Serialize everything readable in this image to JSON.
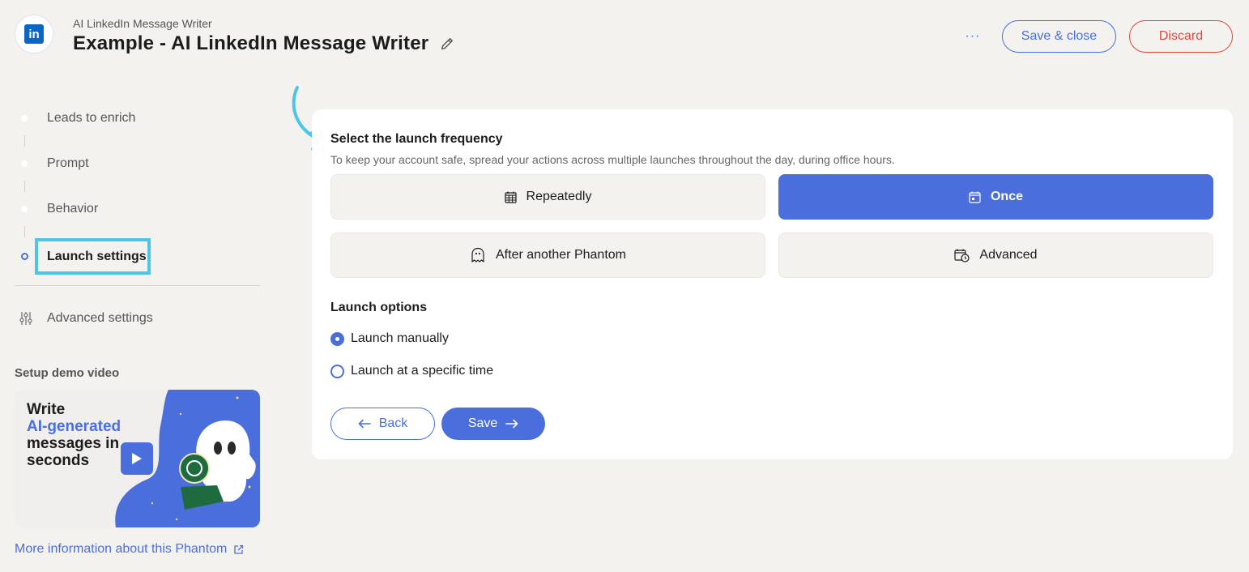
{
  "header": {
    "subtitle": "AI LinkedIn Message Writer",
    "title": "Example - AI LinkedIn Message Writer",
    "logo_text": "in",
    "more_label": "···",
    "save_close_label": "Save & close",
    "discard_label": "Discard"
  },
  "sidebar": {
    "steps": [
      {
        "label": "Leads to enrich"
      },
      {
        "label": "Prompt"
      },
      {
        "label": "Behavior"
      },
      {
        "label": "Launch settings"
      }
    ],
    "advanced_label": "Advanced settings",
    "demo_heading": "Setup demo video",
    "demo": {
      "line1": "Write",
      "line2": "AI-generated",
      "line3": "messages in",
      "line4": "seconds"
    },
    "more_info_label": "More information about this Phantom"
  },
  "main": {
    "section_title": "Select the launch frequency",
    "section_desc": "To keep your account safe, spread your actions across multiple launches throughout the day, during office hours.",
    "frequency": {
      "repeatedly": "Repeatedly",
      "once": "Once",
      "after_phantom": "After another Phantom",
      "advanced": "Advanced"
    },
    "options_title": "Launch options",
    "options": {
      "manual": "Launch manually",
      "specific": "Launch at a specific time"
    },
    "back_label": "Back",
    "save_label": "Save"
  },
  "colors": {
    "accent": "#4a6fdc",
    "highlight": "#4cc6e8",
    "danger": "#e0463a",
    "background": "#f4f2ef"
  }
}
